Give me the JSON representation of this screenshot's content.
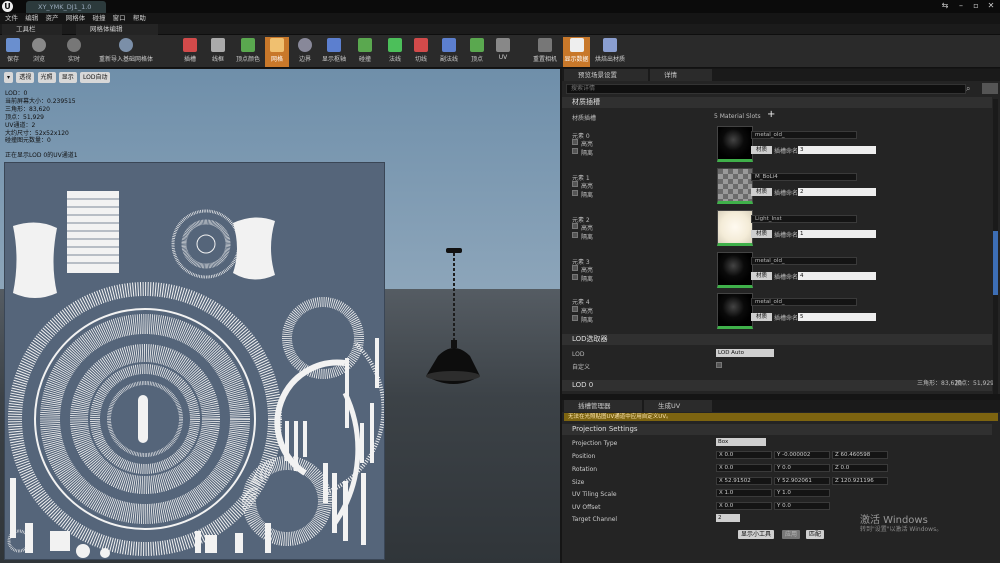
{
  "title_tab": "XY_YMK_DJ1_1.0",
  "menu": [
    "文件",
    "编辑",
    "资产",
    "网格体",
    "碰撞",
    "窗口",
    "帮助"
  ],
  "panel_tabs": {
    "toolbar": "工具栏",
    "mesh_editor": "网格体编辑"
  },
  "toolbar": [
    "保存",
    "浏览",
    "实时",
    "重新导入基础网格体",
    "插槽",
    "线框",
    "顶点颜色",
    "网格",
    "边界",
    "显示枢轴",
    "碰撞",
    "法线",
    "切线",
    "副法线",
    "顶点",
    "UV",
    "重置相机",
    "显示数据",
    "烘焙出材质"
  ],
  "viewport": {
    "buttons": [
      "▾",
      "透视",
      "光照",
      "显示",
      "LOD自动"
    ],
    "stats": [
      "LOD：0",
      "当前屏幕大小：0.239515",
      "三角形：83,620",
      "顶点：51,929",
      "UV通道：2",
      "大约尺寸：52x52x120",
      "碰撞图元数量：0",
      "正在显示LOD 0的UV通道1"
    ]
  },
  "details": {
    "tabs": [
      "预览场景设置",
      "详情"
    ],
    "search_placeholder": "搜索详情",
    "section_materials": "材质插槽",
    "materials_label": "材质插槽",
    "slots_count": "5 Material Slots",
    "element_label": [
      "元素 0",
      "元素 1",
      "元素 2",
      "元素 3",
      "元素 4"
    ],
    "highlight_label": "高亮",
    "isolate_label": "隔离",
    "material_names": [
      "metal_old_",
      "M_BoLi4",
      "Light_Inst",
      "metal_old_",
      "metal_old_"
    ],
    "slot_btn": "材质",
    "slot_name_label": "插槽命名",
    "slot_names": [
      "3",
      "2",
      "1",
      "4",
      "5"
    ],
    "lod_section": "LOD选取器",
    "lod_label": "LOD",
    "lod_value": "LOD Auto",
    "custom_label": "自定义",
    "lod0": "LOD 0",
    "tri_count": "三角形：83,620",
    "vert_count": "顶点：51,929"
  },
  "uvmgr": {
    "tabs": [
      "插槽管理器",
      "生成UV"
    ],
    "warning": "无法在光照贴图UV通道中应用自定义UV。",
    "section": "Projection Settings",
    "projection_type_label": "Projection Type",
    "projection_type": "Box",
    "position_label": "Position",
    "position": [
      "X 0.0",
      "Y -0.000002",
      "Z 60.460598"
    ],
    "rotation_label": "Rotation",
    "rotation": [
      "X 0.0",
      "Y 0.0",
      "Z 0.0"
    ],
    "size_label": "Size",
    "size": [
      "X 52.91502",
      "Y 52.902061",
      "Z 120.921196"
    ],
    "tiling_label": "UV Tiling Scale",
    "tiling": [
      "X 1.0",
      "Y 1.0"
    ],
    "offset_label": "UV Offset",
    "offset": [
      "X 0.0",
      "Y 0.0"
    ],
    "target_label": "Target Channel",
    "target": "2",
    "buttons": [
      "显示小工具",
      "应用",
      "匹配"
    ]
  },
  "watermark": {
    "line1": "激活 Windows",
    "line2": "转到\"设置\"以激活 Windows。"
  }
}
